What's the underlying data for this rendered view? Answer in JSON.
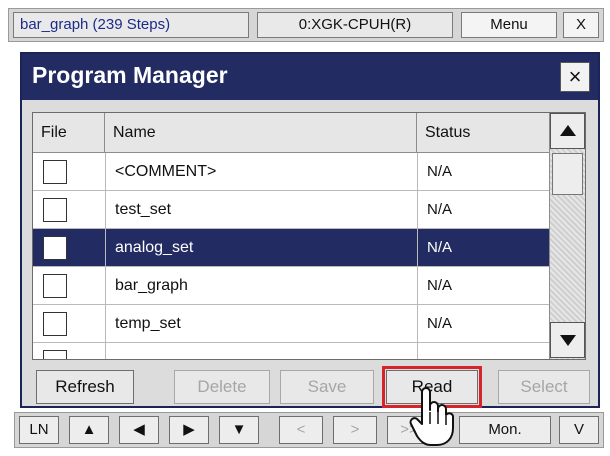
{
  "topbar": {
    "program": "bar_graph (239 Steps)",
    "cpu": "0:XGK-CPUH(R)",
    "menu": "Menu",
    "close": "X"
  },
  "dialog": {
    "title": "Program Manager",
    "close": "×"
  },
  "table": {
    "columns": [
      "File",
      "Name",
      "Status"
    ],
    "rows": [
      {
        "name": "<COMMENT>",
        "status": "N/A",
        "selected": false
      },
      {
        "name": "test_set",
        "status": "N/A",
        "selected": false
      },
      {
        "name": "analog_set",
        "status": "N/A",
        "selected": true
      },
      {
        "name": "bar_graph",
        "status": "N/A",
        "selected": false
      },
      {
        "name": "temp_set",
        "status": "N/A",
        "selected": false
      }
    ]
  },
  "buttons": {
    "refresh": "Refresh",
    "delete": "Delete",
    "save": "Save",
    "read": "Read",
    "select": "Select"
  },
  "bottombar": {
    "ln": "LN",
    "up": "▲",
    "left": "◀",
    "right": "▶",
    "down": "▼",
    "prev": "<",
    "next": ">",
    "ff": ">>",
    "mon": "Mon.",
    "v": "V"
  },
  "colors": {
    "title_bar": "#232c62",
    "selected_row": "#232c62",
    "highlight_border": "#d6242b"
  },
  "icons": {
    "scroll_up": "triangle-up-icon",
    "scroll_down": "triangle-down-icon",
    "cursor": "hand-pointer-icon"
  }
}
